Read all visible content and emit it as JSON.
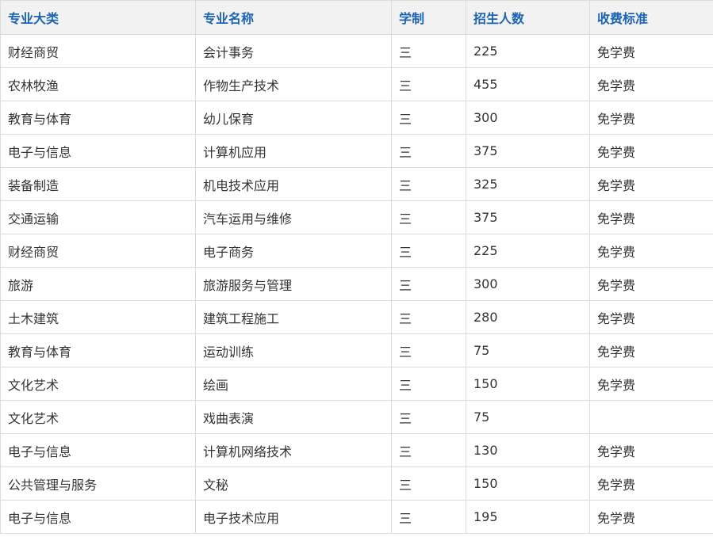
{
  "table": {
    "headers": [
      "专业大类",
      "专业名称",
      "学制",
      "招生人数",
      "收费标准"
    ],
    "rows": [
      {
        "category": "财经商贸",
        "major": "会计事务",
        "years": "三",
        "enrollment": "225",
        "fee": "免学费"
      },
      {
        "category": "农林牧渔",
        "major": "作物生产技术",
        "years": "三",
        "enrollment": "455",
        "fee": "免学费"
      },
      {
        "category": "教育与体育",
        "major": "幼儿保育",
        "years": "三",
        "enrollment": "300",
        "fee": "免学费"
      },
      {
        "category": "电子与信息",
        "major": "计算机应用",
        "years": "三",
        "enrollment": "375",
        "fee": "免学费"
      },
      {
        "category": "装备制造",
        "major": "机电技术应用",
        "years": "三",
        "enrollment": "325",
        "fee": "免学费"
      },
      {
        "category": "交通运输",
        "major": "汽车运用与维修",
        "years": "三",
        "enrollment": "375",
        "fee": "免学费"
      },
      {
        "category": "财经商贸",
        "major": "电子商务",
        "years": "三",
        "enrollment": "225",
        "fee": "免学费"
      },
      {
        "category": "旅游",
        "major": "旅游服务与管理",
        "years": "三",
        "enrollment": "300",
        "fee": "免学费"
      },
      {
        "category": "土木建筑",
        "major": "建筑工程施工",
        "years": "三",
        "enrollment": "280",
        "fee": "免学费"
      },
      {
        "category": "教育与体育",
        "major": "运动训练",
        "years": "三",
        "enrollment": "75",
        "fee": "免学费"
      },
      {
        "category": "文化艺术",
        "major": "绘画",
        "years": "三",
        "enrollment": "150",
        "fee": "免学费"
      },
      {
        "category": "文化艺术",
        "major": "戏曲表演",
        "years": "三",
        "enrollment": "75",
        "fee": ""
      },
      {
        "category": "电子与信息",
        "major": "计算机网络技术",
        "years": "三",
        "enrollment": "130",
        "fee": "免学费"
      },
      {
        "category": "公共管理与服务",
        "major": "文秘",
        "years": "三",
        "enrollment": "150",
        "fee": "免学费"
      },
      {
        "category": "电子与信息",
        "major": "电子技术应用",
        "years": "三",
        "enrollment": "195",
        "fee": "免学费"
      }
    ]
  },
  "colors": {
    "header_text": "#1a64b4",
    "header_bg": "#f2f2f2",
    "body_text": "#333333",
    "border": "#dcdcdc"
  }
}
